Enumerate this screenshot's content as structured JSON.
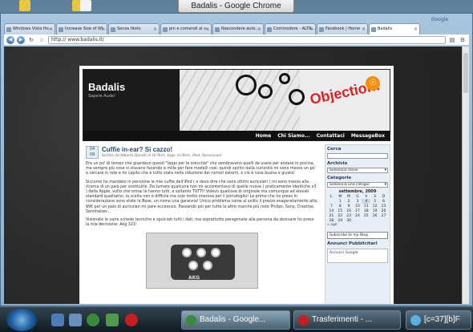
{
  "desktop": {
    "icon_label": ""
  },
  "window": {
    "title": "Badalis - Google Chrome",
    "google_label": "Google"
  },
  "tabs": [
    {
      "label": "Windows Vista Ho...",
      "active": false
    },
    {
      "label": "Increase Size of Wi...",
      "active": false
    },
    {
      "label": "Senza titolo",
      "active": false
    },
    {
      "label": "pin e comandi al s...",
      "active": false
    },
    {
      "label": "Nascondere auto...",
      "active": false
    },
    {
      "label": "Commodore - ALTR...",
      "active": false
    },
    {
      "label": "Facebook | Home",
      "active": false
    },
    {
      "label": "Badalis",
      "active": true
    }
  ],
  "toolbar": {
    "url": "http:// www.badalis.it/"
  },
  "site": {
    "name": "Badalis",
    "tagline": "Sapere Aude!",
    "header_art_text": "Objection!",
    "nav": [
      "Home",
      "Chi Siamo...",
      "Contattaci",
      "MessageBox"
    ]
  },
  "post": {
    "date_day": "04",
    "date_month": "09",
    "title": "Cuffie in-ear? Si cazzo!",
    "meta": "Scritto da Alberto Donati in Hi-Tech. tags: Hi-Tech, iPod, Recensioni",
    "paragraphs": [
      "Era un po' di tempo che guardavo questi \"tappi per le orecchie\" che sembravano quelli da usare per andare in piscina, ma sempre più cose si stavano facendo e mille per fare modelli così: quindi spinto dalla curiosità mi sono messo un po' a cercare in rete e ho capito che è tutto stata nella riduzione dei rumori esterni, e ciò è cosa buona e giusta!",
      "Siccome ho mandato in pensione le mie cuffie dell'iPod ( e devo dire che sono ottimi auricolari ) mi sono messo alla ricerca di un paio per sostituirle. Da tumare qualcuna non mi accontentavo di quelle nuove ( praticamente identiche x3 ) della Apple, volto che ormai le hanno tutti, e soltanto TUTTI! Volevo qualcosa di originale ma comunque ad elevati standard qualitativi, la scelta non è difficile ma solo molto onerosa per il portafoglio! Le prime che ho preso in considerazione sono state le Bose, un nome una garanzia! Unico problema come al solito il prezzo esageratamente alto, 99€ per un paio di auricolari mi pare eccessivo. Passando poi per tutte le altre marche più note Philips, Sony, Creative, Sennheiser...",
      "Visionate le varie schede tecniche e spulciati tutti i dati, ma soprattutto paragonate alla persona da sborsare ho preso la mia decisione: Akg 321!"
    ],
    "image_label": "AKG"
  },
  "sidebar": {
    "search_title": "Cerca",
    "archive_title": "Archivio",
    "archive_select": "Seleziona mese",
    "categories_title": "Categorie",
    "categories_select": "Seleziona una categor",
    "calendar_title": "settembre, 2009",
    "calendar_header": [
      "L",
      "M",
      "M",
      "G",
      "V",
      "S",
      "D"
    ],
    "calendar_rows": [
      [
        "",
        "1",
        "2",
        "3",
        "4",
        "5",
        "6"
      ],
      [
        "7",
        "8",
        "9",
        "10",
        "11",
        "12",
        "13"
      ],
      [
        "14",
        "15",
        "16",
        "17",
        "18",
        "19",
        "20"
      ],
      [
        "21",
        "22",
        "23",
        "24",
        "25",
        "26",
        "27"
      ],
      [
        "28",
        "29",
        "30",
        "",
        "",
        "",
        ""
      ]
    ],
    "prev_link": "« ago",
    "subscribe": "Subscribe to my Blog",
    "ads_title": "Annunci Pubblicitari",
    "ads_text": "Annunci Google"
  },
  "taskbar": {
    "tasks": [
      {
        "label": "Badalis - Google...",
        "active": true
      },
      {
        "label": "Trasferimenti - ...",
        "active": false
      },
      {
        "label": "[c=37][b]F",
        "active": false
      }
    ]
  }
}
